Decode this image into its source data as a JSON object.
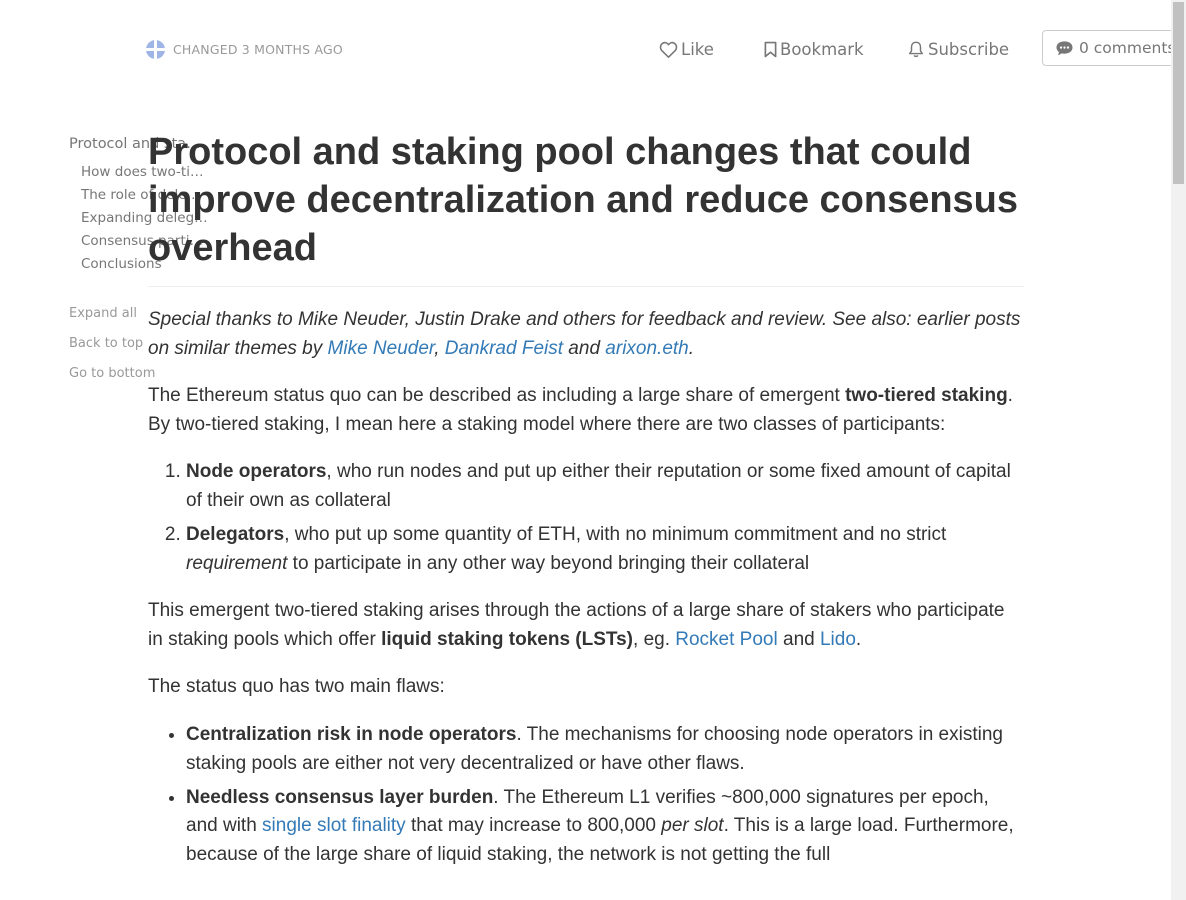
{
  "header": {
    "changed": "CHANGED 3 MONTHS AGO",
    "like": "Like",
    "bookmark": "Bookmark",
    "subscribe": "Subscribe",
    "comments": "0 comments"
  },
  "toc": {
    "items": [
      "Protocol and staking pool changes that could improve decentralization and reduce consensus overhead",
      "How does two-tiered staking work today?",
      "The role of delegators",
      "Expanding delegator responsibilities",
      "Consensus participation",
      "Conclusions"
    ],
    "expand_all": "Expand all",
    "back_to_top": "Back to top",
    "go_to_bottom": "Go to bottom"
  },
  "article": {
    "title": "Protocol and staking pool changes that could improve decentralization and reduce consensus overhead",
    "thanks": {
      "text": "Special thanks to Mike Neuder, Justin Drake and others for feedback and review. See also: earlier posts on similar themes by ",
      "link1": "Mike Neuder",
      "sep1": ", ",
      "link2": "Dankrad Feist",
      "sep2": " and ",
      "link3": "arixon.eth",
      "end": "."
    },
    "p1": {
      "a": "The Ethereum status quo can be described as including a large share of emergent ",
      "b": "two-tiered staking",
      "c": ". By two-tiered staking, I mean here a staking model where there are two classes of participants:"
    },
    "list1": [
      {
        "bold": "Node operators",
        "rest": ", who run nodes and put up either their reputation or some fixed amount of capital of their own as collateral"
      },
      {
        "bold": "Delegators",
        "rest": ", who put up some quantity of ETH, with no minimum commitment and no strict ",
        "em": "requirement",
        "rest2": " to participate in any other way beyond bringing their collateral"
      }
    ],
    "p2": {
      "a": "This emergent two-tiered staking arises through the actions of a large share of stakers who participate in staking pools which offer ",
      "b": "liquid staking tokens (LSTs)",
      "c": ", eg. ",
      "link1": "Rocket Pool",
      "d": " and ",
      "link2": "Lido",
      "e": "."
    },
    "p3": "The status quo has two main flaws:",
    "list2": [
      {
        "bold": "Centralization risk in node operators",
        "rest": ". The mechanisms for choosing node operators in existing staking pools are either not very decentralized or have other flaws."
      },
      {
        "bold": "Needless consensus layer burden",
        "rest": ". The Ethereum L1 verifies ~800,000 signatures per epoch, and with ",
        "link": "single slot finality",
        "rest2": " that may increase to 800,000 ",
        "em": "per slot",
        "rest3": ". This is a large load. Furthermore, because of the large share of liquid staking, the network is not getting the full"
      }
    ]
  },
  "colors": {
    "link": "#337ab7",
    "text": "#333333",
    "muted": "#777777"
  }
}
